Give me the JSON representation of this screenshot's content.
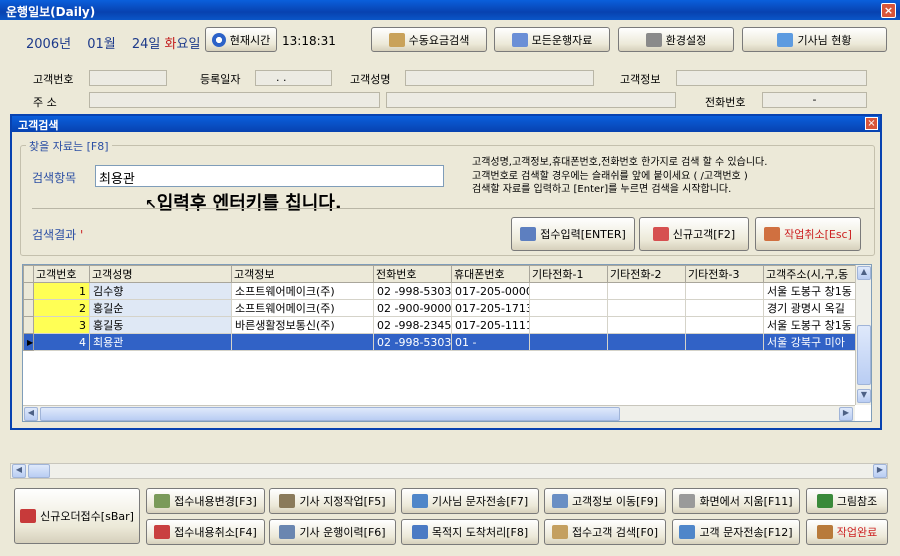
{
  "window": {
    "title": "운행일보(Daily)"
  },
  "header": {
    "year": "2006",
    "year_unit": "년",
    "month": "01",
    "month_unit": "월",
    "day": "24",
    "day_unit": "일",
    "weekday": "화",
    "weekday_unit": "요일",
    "now_button": "현재시간",
    "clock": "13:18:31",
    "buttons": [
      "수동요금검색",
      "모든운행자료",
      "환경설정",
      "기사님 현황"
    ]
  },
  "customer_form": {
    "customer_no_label": "고객번호",
    "reg_date_label": "등록일자",
    "reg_date_value": " .   .",
    "customer_name_label": "고객성명",
    "customer_info_label": "고객정보",
    "address_label": "주    소",
    "phone_label": "전화번호",
    "phone_value": "-"
  },
  "dialog": {
    "title": "고객검색",
    "group_label": "찾을 자료는 [F8]",
    "search_item_label": "검색항목",
    "search_value": "최용관",
    "help_lines": [
      "고객성명,고객정보,휴대폰번호,전화번호 한가지로 검색 할 수 있습니다.",
      "고객번호로 검색할 경우에는 슬래쉬를 앞에 붙이세요 ( /고객번호 )",
      "검색할 자료를 입력하고 [Enter]를 누르면 검색을 시작합니다."
    ],
    "hint_overlay": "입력후 엔터키를 칩니다.",
    "result_label": "검색결과",
    "result_marker": "'",
    "buttons": {
      "accept": "접수입력[ENTER]",
      "new_customer": "신규고객[F2]",
      "cancel": "작업취소[Esc]"
    },
    "columns": [
      "고객번호",
      "고객성명",
      "고객정보",
      "전화번호",
      "휴대폰번호",
      "기타전화-1",
      "기타전화-2",
      "기타전화-3",
      "고객주소(시,구,동"
    ],
    "rows": [
      {
        "no": "1",
        "name": "김수향",
        "info": "소프트웨어메이크(주)",
        "phone": "02   -998-5303",
        "mobile": "017-205-0000",
        "e1": "",
        "e2": "",
        "e3": "",
        "addr": "서울 도봉구 창1동"
      },
      {
        "no": "2",
        "name": "홍길순",
        "info": "소프트웨어메이크(주)",
        "phone": "02   -900-9000",
        "mobile": "017-205-1713",
        "e1": "",
        "e2": "",
        "e3": "",
        "addr": "경기 광명시 옥길"
      },
      {
        "no": "3",
        "name": "홍길동",
        "info": "바른생활정보통신(주)",
        "phone": "02   -998-2345",
        "mobile": "017-205-1111",
        "e1": "",
        "e2": "",
        "e3": "",
        "addr": "서울 도봉구 창1동"
      },
      {
        "no": "4",
        "name": "최용관",
        "info": "",
        "phone": "02   -998-5303",
        "mobile": "01 -",
        "e1": "",
        "e2": "",
        "e3": "",
        "addr": "서울 강북구 미아"
      }
    ],
    "selected_row": 3
  },
  "bottom_bar": {
    "new_order": "신규오더접수[sBar]",
    "buttons_top": [
      "접수내용변경[F3]",
      "기사 지정작업[F5]",
      "기사님 문자전송[F7]",
      "고객정보 이동[F9]",
      "화면에서 지움[F11]",
      "그림참조"
    ],
    "buttons_bottom": [
      "접수내용취소[F4]",
      "기사 운행이력[F6]",
      "목적지 도착처리[F8]",
      "접수고객 검색[F0]",
      "고객 문자전송[F12]",
      "작업완료"
    ]
  },
  "colors": {
    "titlebar": "#0842b0",
    "selected_row": "#3162c6",
    "number_cell": "#ffff55",
    "accent_red": "#cc2222"
  }
}
